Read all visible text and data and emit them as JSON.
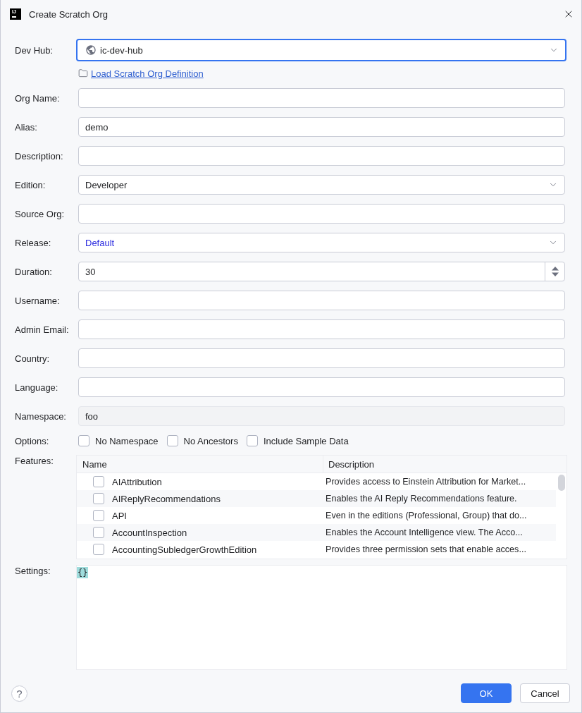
{
  "window": {
    "title": "Create Scratch Org",
    "logo_text": "IJ"
  },
  "dev_hub": {
    "label": "Dev Hub:",
    "value": "ic-dev-hub",
    "focused": true
  },
  "load_definition_link": "Load Scratch Org Definition",
  "fields": [
    {
      "kind": "text",
      "label": "Org Name:",
      "disabled": false
    },
    {
      "kind": "text",
      "label": "Alias:",
      "value": "demo",
      "disabled": false,
      "default_value": false
    },
    {
      "kind": "text",
      "label": "Description:",
      "disabled": false
    },
    {
      "kind": "select",
      "label": "Edition:",
      "value": "Developer",
      "disabled": false,
      "default_value": false
    },
    {
      "kind": "text",
      "label": "Source Org:",
      "disabled": false
    },
    {
      "kind": "select",
      "label": "Release:",
      "value": "Default",
      "disabled": false,
      "default_value": true
    },
    {
      "kind": "spinner",
      "label": "Duration:",
      "value": "30",
      "disabled": false,
      "default_value": false
    },
    {
      "kind": "text",
      "label": "Username:",
      "disabled": false
    },
    {
      "kind": "text",
      "label": "Admin Email:",
      "disabled": false
    },
    {
      "kind": "text",
      "label": "Country:",
      "disabled": false
    },
    {
      "kind": "text",
      "label": "Language:",
      "disabled": false
    },
    {
      "kind": "text",
      "label": "Namespace:",
      "value": "foo",
      "disabled": true,
      "default_value": false
    }
  ],
  "options": {
    "label": "Options:",
    "items": [
      {
        "label": "No Namespace",
        "checked": false
      },
      {
        "label": "No Ancestors",
        "checked": false
      },
      {
        "label": "Include Sample Data",
        "checked": false
      }
    ]
  },
  "features": {
    "label": "Features:",
    "columns": [
      "Name",
      "Description"
    ],
    "rows": [
      {
        "name": "AIAttribution",
        "description": "Provides access to Einstein Attribution for Market...",
        "checked": false
      },
      {
        "name": "AIReplyRecommendations",
        "description": "Enables the AI Reply Recommendations feature.",
        "checked": false
      },
      {
        "name": "API",
        "description": "Even in the editions (Professional, Group) that do...",
        "checked": false
      },
      {
        "name": "AccountInspection",
        "description": "Enables the Account Intelligence view. The Acco...",
        "checked": false
      },
      {
        "name": "AccountingSubledgerGrowthEdition",
        "description": "Provides three permission sets that enable acces...",
        "checked": false
      }
    ]
  },
  "settings": {
    "label": "Settings:",
    "value": "{}",
    "brace_match": true
  },
  "help_button": "?",
  "buttons": [
    {
      "label": "OK",
      "primary": true
    },
    {
      "label": "Cancel",
      "primary": false
    }
  ]
}
